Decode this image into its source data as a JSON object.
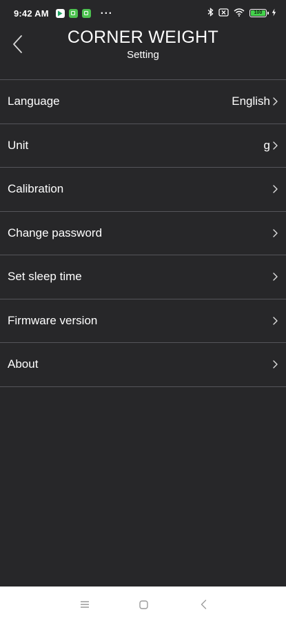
{
  "status_bar": {
    "time": "9:42 AM",
    "dots": "···",
    "battery_level": "100",
    "icons": [
      "play-store-icon",
      "app-notification-icon",
      "app-notification-icon",
      "bluetooth-icon",
      "no-sim-icon",
      "wifi-icon",
      "battery-icon",
      "charging-icon"
    ]
  },
  "header": {
    "title": "CORNER WEIGHT",
    "subtitle": "Setting",
    "back_icon": "back-arrow-icon"
  },
  "settings": {
    "items": [
      {
        "label": "Language",
        "value": "English"
      },
      {
        "label": "Unit",
        "value": "g"
      },
      {
        "label": "Calibration",
        "value": ""
      },
      {
        "label": "Change password",
        "value": ""
      },
      {
        "label": "Set sleep time",
        "value": ""
      },
      {
        "label": "Firmware version",
        "value": ""
      },
      {
        "label": "About",
        "value": ""
      }
    ]
  },
  "nav_bar": {
    "buttons": [
      "menu-icon",
      "home-icon",
      "back-icon"
    ]
  },
  "colors": {
    "background": "#272729",
    "divider": "#55555a",
    "text": "#ffffff",
    "nav_background": "#ffffff",
    "battery_fill": "#44d24c"
  }
}
